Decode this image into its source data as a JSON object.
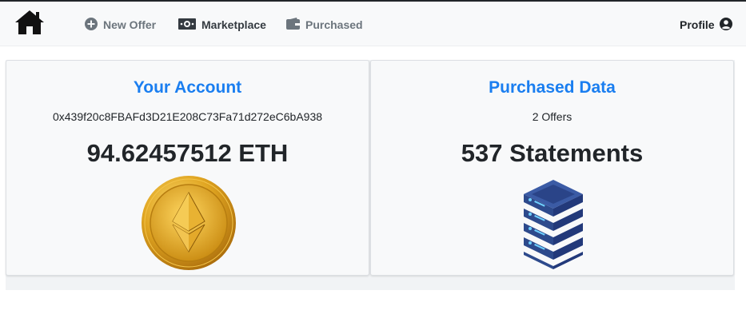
{
  "nav": {
    "home_icon": "home-icon",
    "items": [
      {
        "label": "New Offer",
        "icon": "plus-circle-icon"
      },
      {
        "label": "Marketplace",
        "icon": "money-bill-icon"
      },
      {
        "label": "Purchased",
        "icon": "wallet-icon"
      }
    ],
    "profile": {
      "label": "Profile",
      "icon": "user-circle-icon"
    }
  },
  "account": {
    "title": "Your Account",
    "address": "0x439f20c8FBAFd3D21E208C73Fa71d272eC6bA938",
    "balance": "94.62457512 ETH",
    "image": "ethereum-coin-icon"
  },
  "purchased": {
    "title": "Purchased Data",
    "offers": "2 Offers",
    "statements": "537 Statements",
    "image": "server-stack-icon"
  },
  "colors": {
    "accent": "#1a7ef0",
    "nav_bg": "#f8f9fa",
    "muted": "#6c757d",
    "server": "#2d4a8c"
  }
}
